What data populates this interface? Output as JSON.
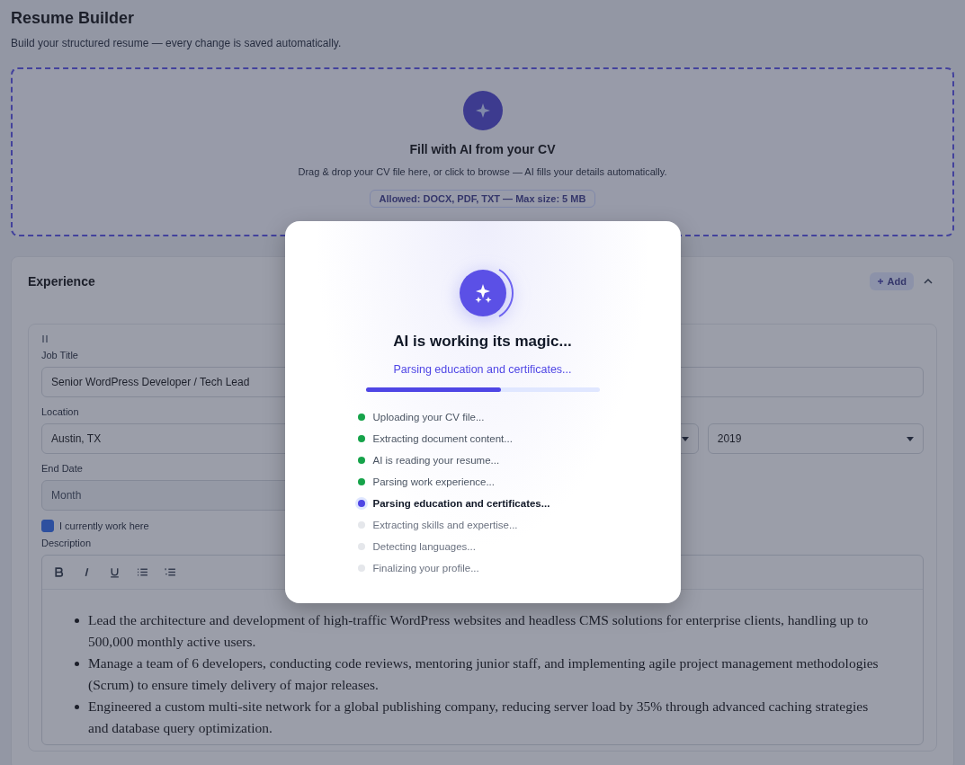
{
  "page": {
    "title": "Resume Builder",
    "subtitle": "Build your structured resume — every change is saved automatically."
  },
  "upload": {
    "title": "Fill with AI from your CV",
    "hint": "Drag & drop your CV file here, or click to browse — AI fills your details automatically.",
    "allowed": "Allowed: DOCX, PDF, TXT — Max size: 5 MB"
  },
  "experience": {
    "title": "Experience",
    "add_button": "Add",
    "expanded": true,
    "entry": {
      "job_title_label": "Job Title",
      "job_title": "Senior WordPress Developer / Tech Lead",
      "location_label": "Location",
      "location": "Austin, TX",
      "start_year": "2019",
      "end_date_label": "End Date",
      "end_month_placeholder": "Month",
      "current_label": "I currently work here",
      "current": true,
      "description_label": "Description",
      "description": [
        "Lead the architecture and development of high-traffic WordPress websites and headless CMS solutions for enterprise clients, handling up to 500,000 monthly active users.",
        "Manage a team of 6 developers, conducting code reviews, mentoring junior staff, and implementing agile project management methodologies (Scrum) to ensure timely delivery of major releases.",
        "Engineered a custom multi-site network for a global publishing company, reducing server load by 35% through advanced caching strategies and database query optimization."
      ]
    }
  },
  "modal": {
    "title": "AI is working its magic...",
    "current_step": "Parsing education and certificates...",
    "level": 0.58,
    "steps": [
      {
        "label": "Uploading your CV file...",
        "kind": "done"
      },
      {
        "label": "Extracting document content...",
        "kind": "done"
      },
      {
        "label": "AI is reading your resume...",
        "kind": "done"
      },
      {
        "label": "Parsing work experience...",
        "kind": "done"
      },
      {
        "label": "Parsing education and certificates...",
        "kind": "active"
      },
      {
        "label": "Extracting skills and expertise...",
        "kind": "pending"
      },
      {
        "label": "Detecting languages...",
        "kind": "pending"
      },
      {
        "label": "Finalizing your profile...",
        "kind": "pending"
      }
    ]
  }
}
